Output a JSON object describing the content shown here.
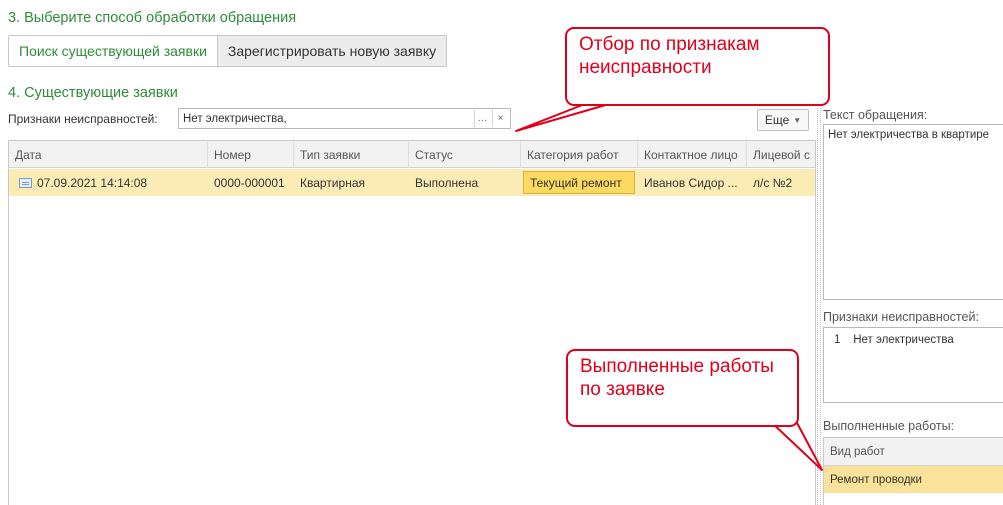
{
  "section3": {
    "title": "3. Выберите способ обработки обращения"
  },
  "tabs": [
    {
      "label": "Поиск существующей заявки",
      "active": true
    },
    {
      "label": "Зарегистрировать новую заявку",
      "active": false
    }
  ],
  "section4": {
    "title": "4. Существующие заявки"
  },
  "filter": {
    "label": "Признаки неисправностей:",
    "value": "Нет электричества,",
    "select_icon": "…",
    "clear_icon": "×"
  },
  "more_button": {
    "label": "Еще",
    "icon": "caret-down-icon"
  },
  "grid": {
    "columns": [
      "Дата",
      "Номер",
      "Тип заявки",
      "Статус",
      "Категория работ",
      "Контактное лицо",
      "Лицевой с"
    ],
    "rows": [
      {
        "icon": "document-icon",
        "date": "07.09.2021 14:14:08",
        "number": "0000-000001",
        "type": "Квартирная",
        "status": "Выполнена",
        "category": "Текущий ремонт",
        "contact": "Иванов Сидор ...",
        "account": "л/с №2"
      }
    ]
  },
  "side": {
    "text_label": "Текст обращения:",
    "text_value": "Нет электричества в квартире",
    "faults_label": "Признаки неисправностей:",
    "faults": [
      {
        "num": "1",
        "label": "Нет электричества"
      }
    ],
    "works_label": "Выполненные работы:",
    "works_column": "Вид работ",
    "works": [
      "Ремонт проводки"
    ]
  },
  "callouts": {
    "filter_note": "Отбор по признакам неисправности",
    "works_note": "Выполненные работы по заявке"
  },
  "colors": {
    "section_green": "#2e8b3a",
    "selected_row": "#fbecb5",
    "selected_cell": "#fcd961",
    "callout_red": "#e0001b"
  }
}
